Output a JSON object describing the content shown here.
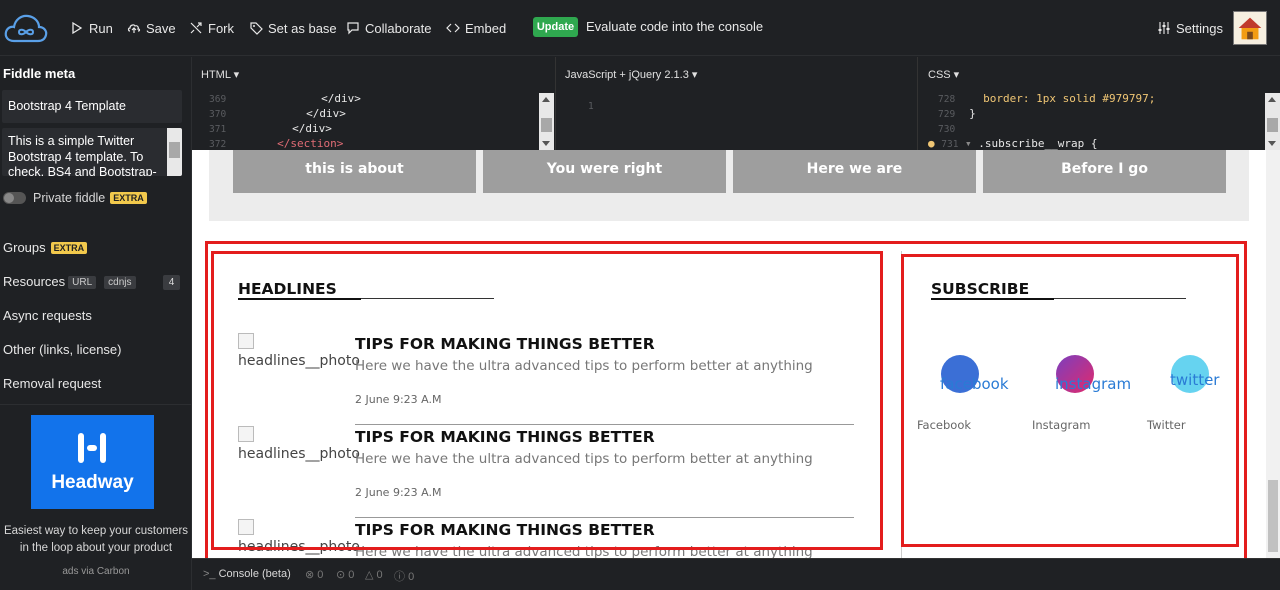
{
  "toolbar": {
    "run": "Run",
    "save": "Save",
    "fork": "Fork",
    "set_as_base": "Set as base",
    "collaborate": "Collaborate",
    "embed": "Embed",
    "update": "Update",
    "update_desc": "Evaluate code into the console",
    "settings": "Settings"
  },
  "sidebar": {
    "title": "Fiddle meta",
    "fiddle_name": "Bootstrap 4 Template",
    "fiddle_desc": "This is a simple Twitter Bootstrap 4 template. To check, BS4 and Bootstrap-",
    "private_label": "Private fiddle",
    "extra_badge": "EXTRA",
    "groups": "Groups",
    "resources": "Resources",
    "resources_url": "URL",
    "resources_cdnjs": "cdnjs",
    "resources_count": "4",
    "async_requests": "Async requests",
    "other": "Other (links, license)",
    "removal": "Removal request",
    "ad_name": "Headway",
    "ad_text": "Easiest way to keep your customers in the loop about your product",
    "ad_via": "ads via Carbon"
  },
  "editors": {
    "html": {
      "label": "HTML ▾",
      "lines": [
        {
          "n": "369",
          "code": "</div>",
          "indent": 14
        },
        {
          "n": "370",
          "code": "</div>",
          "indent": 12
        },
        {
          "n": "371",
          "code": "</div>",
          "indent": 10
        },
        {
          "n": "372",
          "code": "</section>",
          "indent": 8
        }
      ]
    },
    "js": {
      "label": "JavaScript + jQuery 2.1.3 ▾",
      "line_number": "1"
    },
    "css": {
      "label": "CSS ▾",
      "lines": [
        {
          "n": "728",
          "code": "border: 1px solid #979797;"
        },
        {
          "n": "729",
          "code": "}"
        },
        {
          "n": "730",
          "code": ""
        },
        {
          "n": "731",
          "code": ".subscribe__wrap {"
        }
      ]
    }
  },
  "result": {
    "nav_buttons": [
      "this is about",
      "You were right",
      "Here we are",
      "Before I go"
    ],
    "headlines_title": "HEADLINES",
    "headlines": [
      {
        "photo_alt": "headlines__photo",
        "title": "TIPS FOR MAKING THINGS BETTER",
        "desc": "Here we have the ultra advanced tips to perform better at anything",
        "date": "2 June 9:23 A.M"
      },
      {
        "photo_alt": "headlines__photo",
        "title": "TIPS FOR MAKING THINGS BETTER",
        "desc": "Here we have the ultra advanced tips to perform better at anything",
        "date": "2 June 9:23 A.M"
      },
      {
        "photo_alt": "headlines__photo",
        "title": "TIPS FOR MAKING THINGS BETTER",
        "desc": "Here we have the ultra advanced tips to perform better at anything",
        "date": ""
      }
    ],
    "subscribe_title": "SUBSCRIBE",
    "socials": [
      {
        "alt": "facebook",
        "label": "Facebook",
        "color": "#3b6fd6"
      },
      {
        "alt": "instagram",
        "label": "Instagram",
        "color": "#b6267a"
      },
      {
        "alt": "twitter",
        "label": "Twitter",
        "color": "#66d3f0"
      }
    ]
  },
  "console": {
    "label": "Console (beta)",
    "counts": [
      "0",
      "0",
      "0",
      "0"
    ]
  },
  "colors": {
    "accent_update": "#2fa84f",
    "annotation_red": "#e31d1d",
    "extra_badge": "#f2c94c",
    "ad_blue": "#1273eb"
  }
}
